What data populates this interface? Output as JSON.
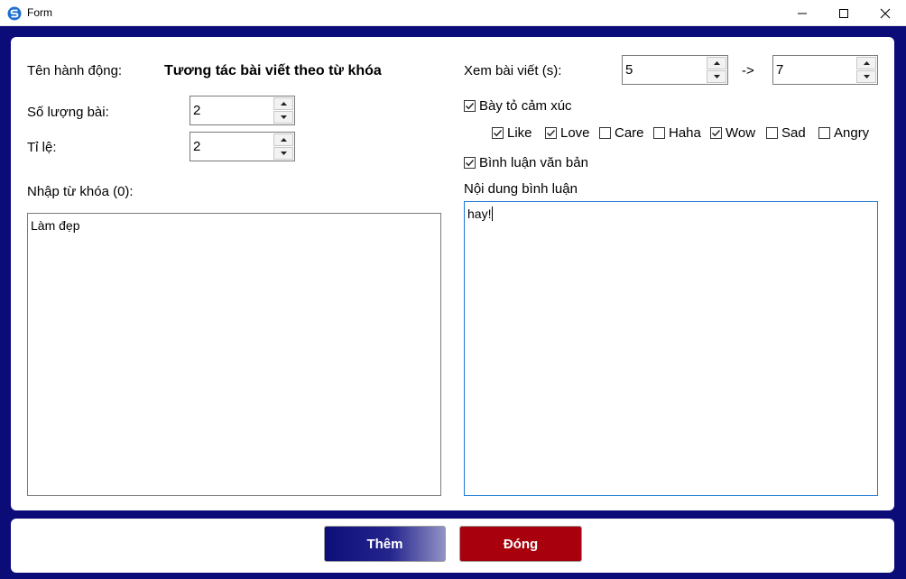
{
  "window": {
    "title": "Form"
  },
  "form": {
    "action_name_label": "Tên hành động:",
    "action_name_value": "Tương tác bài viết theo từ khóa",
    "post_count_label": "Số lượng bài:",
    "post_count_value": "2",
    "ratio_label": "Tỉ lệ:",
    "ratio_value": "2",
    "keywords_label": "Nhập từ khóa (0):",
    "keywords_value": "Làm đẹp",
    "view_time_label": "Xem bài viết (s):",
    "view_time_from": "5",
    "view_time_arrow": "->",
    "view_time_to": "7",
    "express_emotion": {
      "label": "Bày tỏ cảm xúc",
      "checked": true
    },
    "reactions": [
      {
        "label": "Like",
        "checked": true
      },
      {
        "label": "Love",
        "checked": true
      },
      {
        "label": "Care",
        "checked": false
      },
      {
        "label": "Haha",
        "checked": false
      },
      {
        "label": "Wow",
        "checked": true
      },
      {
        "label": "Sad",
        "checked": false
      },
      {
        "label": "Angry",
        "checked": false
      }
    ],
    "text_comment": {
      "label": "Bình luận văn bản",
      "checked": true
    },
    "comment_content_label": "Nội dung bình luận",
    "comment_content_value": "hay!"
  },
  "buttons": {
    "add_label": "Thêm",
    "close_label": "Đóng"
  },
  "colors": {
    "frame": "#0c0c78",
    "close_button": "#a8000c",
    "focus_border": "#1e7bd1"
  }
}
